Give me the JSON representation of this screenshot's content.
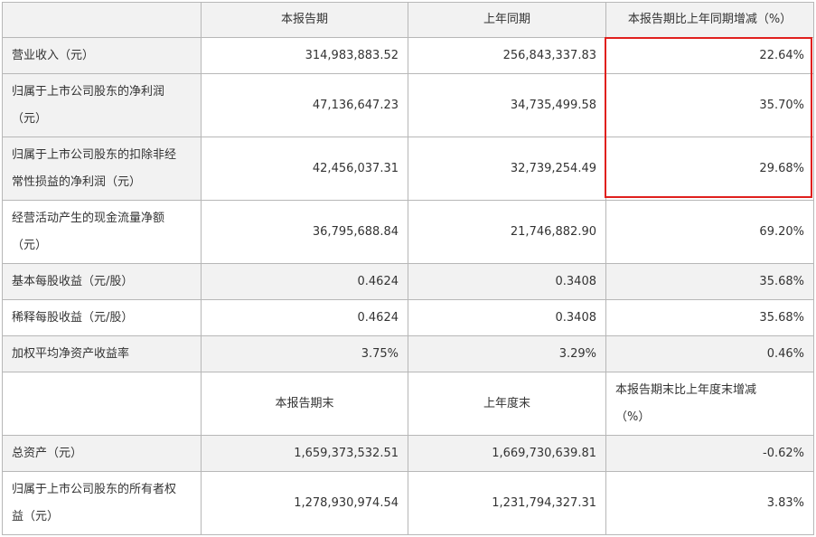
{
  "header": {
    "col1": "本报告期",
    "col2": "上年同期",
    "col3": "本报告期比上年同期增减（%）"
  },
  "rows": [
    {
      "label": "营业收入（元）",
      "current": "314,983,883.52",
      "prior": "256,843,337.83",
      "change": "22.64%"
    },
    {
      "label_line1": "归属于上市公司股东的净利润",
      "label_line2": "（元）",
      "current": "47,136,647.23",
      "prior": "34,735,499.58",
      "change": "35.70%"
    },
    {
      "label_line1": "归属于上市公司股东的扣除非经",
      "label_line2": "常性损益的净利润（元）",
      "current": "42,456,037.31",
      "prior": "32,739,254.49",
      "change": "29.68%"
    },
    {
      "label_line1": "经营活动产生的现金流量净额",
      "label_line2": "（元）",
      "current": "36,795,688.84",
      "prior": "21,746,882.90",
      "change": "69.20%"
    },
    {
      "label": "基本每股收益（元/股）",
      "current": "0.4624",
      "prior": "0.3408",
      "change": "35.68%"
    },
    {
      "label": "稀释每股收益（元/股）",
      "current": "0.4624",
      "prior": "0.3408",
      "change": "35.68%"
    },
    {
      "label": "加权平均净资产收益率",
      "current": "3.75%",
      "prior": "3.29%",
      "change": "0.46%"
    }
  ],
  "header2": {
    "col1": "本报告期末",
    "col2": "上年度末",
    "col3_line1": "本报告期末比上年度末增减",
    "col3_line2": "（%）"
  },
  "rows2": [
    {
      "label": "总资产（元）",
      "current": "1,659,373,532.51",
      "prior": "1,669,730,639.81",
      "change": "-0.62%"
    },
    {
      "label_line1": "归属于上市公司股东的所有者权",
      "label_line2": "益（元）",
      "current": "1,278,930,974.54",
      "prior": "1,231,794,327.31",
      "change": "3.83%"
    }
  ],
  "highlight_color": "#e0201d"
}
